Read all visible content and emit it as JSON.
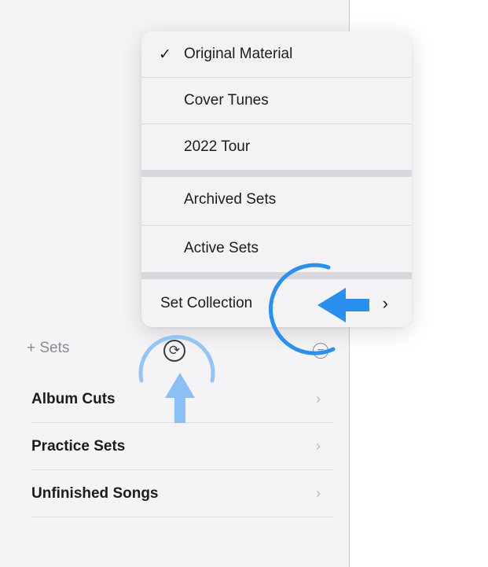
{
  "menu": {
    "items": [
      {
        "label": "Original Material",
        "checked": true
      },
      {
        "label": "Cover Tunes",
        "checked": false
      },
      {
        "label": "2022 Tour",
        "checked": false
      }
    ],
    "filters": [
      {
        "label": "Archived Sets"
      },
      {
        "label": "Active Sets"
      }
    ],
    "submenu": {
      "label": "Set Collection",
      "chevron": "›"
    },
    "check_glyph": "✓"
  },
  "sidebar": {
    "add_label": "+ Sets",
    "cycle_icon": "⟳",
    "minus_icon": "−"
  },
  "sets": [
    {
      "name": "Album Cuts",
      "chevron": "›"
    },
    {
      "name": "Practice Sets",
      "chevron": "›"
    },
    {
      "name": "Unfinished Songs",
      "chevron": "›"
    }
  ],
  "annotation_color": "#2b8ff0"
}
